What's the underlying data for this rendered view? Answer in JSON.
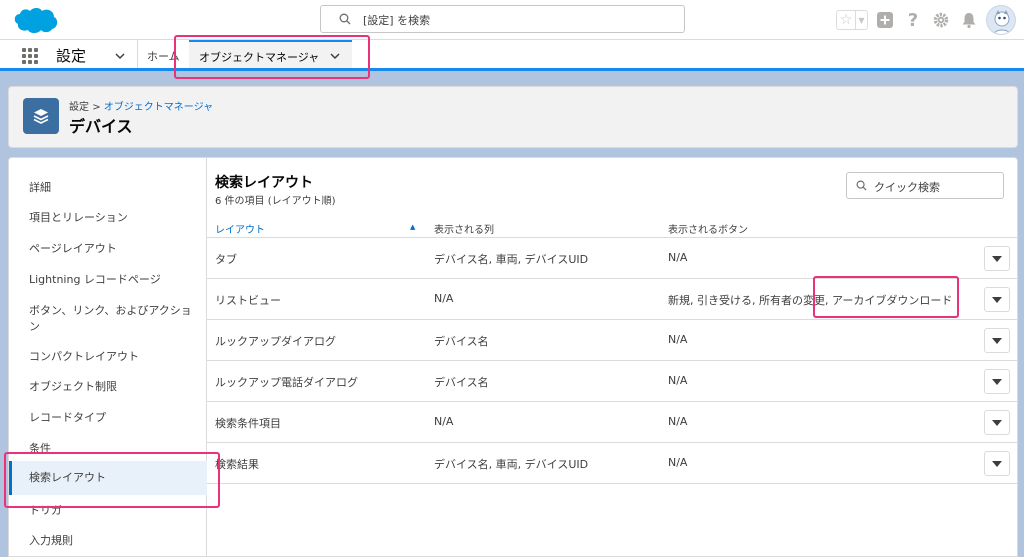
{
  "header": {
    "search_placeholder": "[設定] を検索",
    "help_glyph": "?"
  },
  "context_bar": {
    "app_name": "設定",
    "home_tab": "ホーム",
    "active_tab": "オブジェクトマネージャ"
  },
  "page_header": {
    "breadcrumb_root": "設定",
    "breadcrumb_separator": ">",
    "breadcrumb_link": "オブジェクトマネージャ",
    "title": "デバイス"
  },
  "sidebar": {
    "items": [
      {
        "label": "詳細"
      },
      {
        "label": "項目とリレーション"
      },
      {
        "label": "ページレイアウト"
      },
      {
        "label": "Lightning レコードページ"
      },
      {
        "label": "ボタン、リンク、およびアクション"
      },
      {
        "label": "コンパクトレイアウト"
      },
      {
        "label": "オブジェクト制限"
      },
      {
        "label": "レコードタイプ"
      },
      {
        "label": "条件"
      },
      {
        "label": "検索レイアウト"
      },
      {
        "label": "トリガ"
      },
      {
        "label": "入力規則"
      }
    ],
    "active_index": 9
  },
  "content": {
    "title": "検索レイアウト",
    "subtitle": "6 件の項目 (レイアウト順)",
    "quick_search_placeholder": "クイック検索",
    "columns": [
      "レイアウト",
      "表示される列",
      "表示されるボタン"
    ],
    "rows": [
      {
        "layout": "タブ",
        "columns": "デバイス名, 車両, デバイスUID",
        "buttons": "N/A"
      },
      {
        "layout": "リストビュー",
        "columns": "N/A",
        "buttons": "新規, 引き受ける, 所有者の変更, アーカイブダウンロード"
      },
      {
        "layout": "ルックアップダイアログ",
        "columns": "デバイス名",
        "buttons": "N/A"
      },
      {
        "layout": "ルックアップ電話ダイアログ",
        "columns": "デバイス名",
        "buttons": "N/A"
      },
      {
        "layout": "検索条件項目",
        "columns": "N/A",
        "buttons": "N/A"
      },
      {
        "layout": "検索結果",
        "columns": "デバイス名, 車両, デバイスUID",
        "buttons": "N/A"
      }
    ]
  },
  "colors": {
    "brand_blue": "#1589ee",
    "link_blue": "#006dcc",
    "highlight": "#e8337a",
    "object_icon": "#3c6fa1"
  }
}
